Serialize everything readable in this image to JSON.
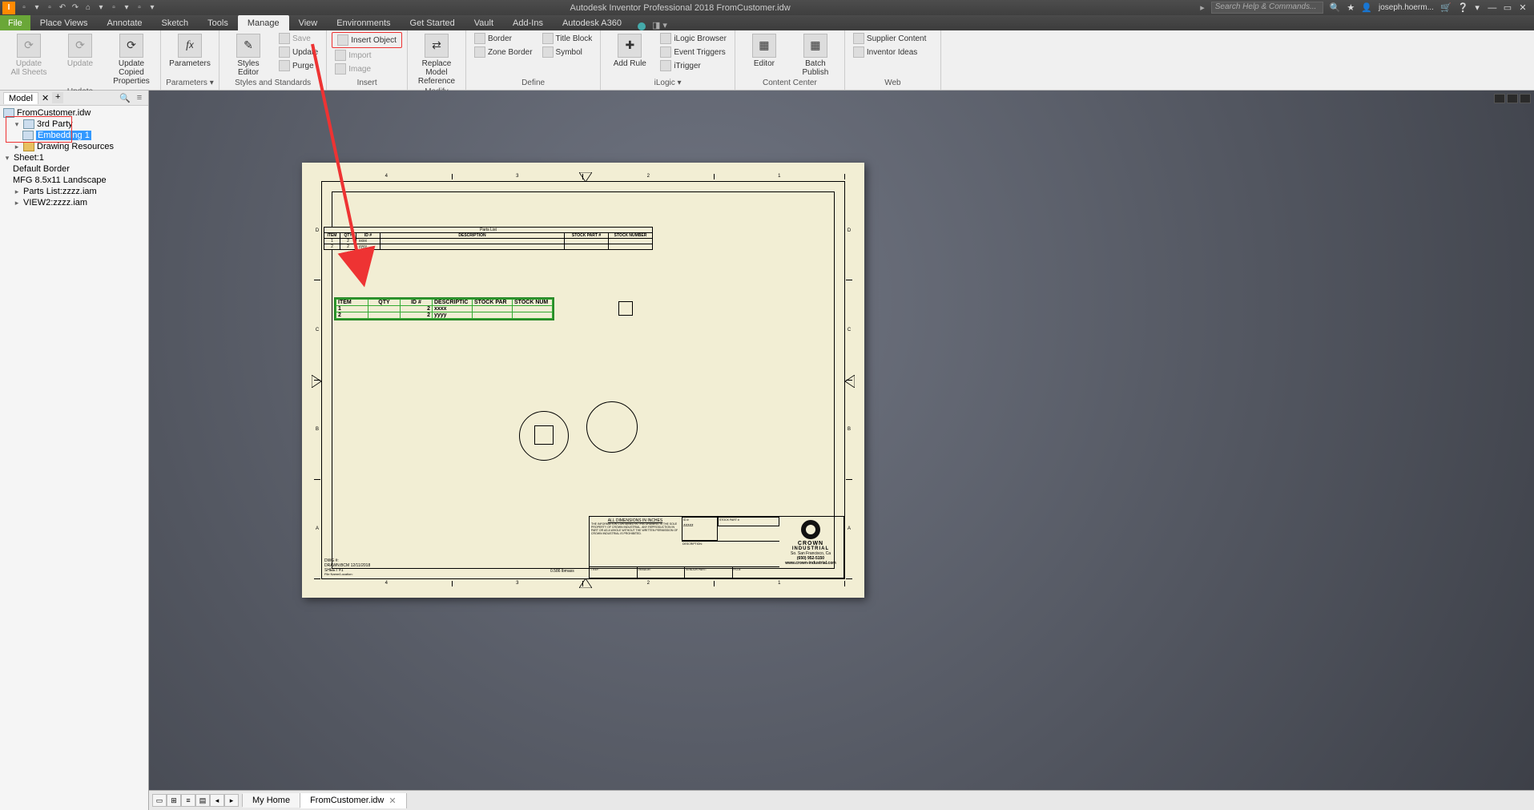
{
  "app": {
    "title": "Autodesk Inventor Professional 2018   FromCustomer.idw",
    "search_placeholder": "Search Help & Commands...",
    "user": "joseph.hoerm..."
  },
  "qat_tooltips": [
    "new",
    "open",
    "save",
    "undo",
    "redo",
    "home",
    "select",
    "print",
    "measure",
    "settings"
  ],
  "menu_tabs": {
    "file": "File",
    "items": [
      "Place Views",
      "Annotate",
      "Sketch",
      "Tools",
      "Manage",
      "View",
      "Environments",
      "Get Started",
      "Vault",
      "Add-Ins",
      "Autodesk A360"
    ],
    "active": "Manage"
  },
  "ribbon": {
    "update": {
      "label": "Update",
      "update_all": "Update\nAll Sheets",
      "update": "Update",
      "update_copied": "Update Copied\nProperties"
    },
    "parameters": {
      "label": "Parameters ▾",
      "fx": "Parameters"
    },
    "styles": {
      "label": "Styles and Standards",
      "editor": "Styles Editor",
      "save": "Save",
      "update": "Update",
      "purge": "Purge"
    },
    "insert": {
      "label": "Insert",
      "object": "Insert Object",
      "import": "Import",
      "image": "Image"
    },
    "modify": {
      "label": "Modify",
      "replace": "Replace Model\nReference"
    },
    "define": {
      "label": "Define",
      "border": "Border",
      "zone": "Zone Border",
      "title": "Title Block",
      "symbol": "Symbol"
    },
    "ilogic": {
      "label": "iLogic  ▾",
      "addrule": "Add Rule",
      "browser": "iLogic Browser",
      "triggers": "Event Triggers",
      "itrigger": "iTrigger"
    },
    "content": {
      "label": "Content Center",
      "editor": "Editor",
      "batch": "Batch Publish"
    },
    "web": {
      "label": "Web",
      "supplier": "Supplier Content",
      "ideas": "Inventor Ideas"
    }
  },
  "model_panel": {
    "tab": "Model",
    "root": "FromCustomer.idw",
    "nodes": {
      "third_party": "3rd Party",
      "embedding": "Embedding 1",
      "drawing_res": "Drawing Resources",
      "sheet": "Sheet:1",
      "border": "Default Border",
      "mfg": "MFG 8.5x11 Landscape",
      "parts": "Parts List:zzzz.iam",
      "view2": "VIEW2:zzzz.iam"
    }
  },
  "parts_list": {
    "title": "Parts List",
    "headers": [
      "ITEM",
      "QTY",
      "ID #",
      "DESCRIPTION",
      "STOCK PART #",
      "STOCK NUMBER"
    ],
    "rows": [
      [
        "1",
        "2",
        "xxxx",
        "",
        "",
        ""
      ],
      [
        "2",
        "2",
        "yyyy",
        "",
        "",
        ""
      ]
    ]
  },
  "embed_table": {
    "headers": [
      "ITEM",
      "QTY",
      "ID #",
      "DESCRIPTIC",
      "STOCK PAR",
      "STOCK NUM"
    ],
    "rows": [
      [
        "1",
        "",
        "2",
        "xxxx",
        "",
        ""
      ],
      [
        "2",
        "",
        "2",
        "yyyy",
        "",
        ""
      ]
    ]
  },
  "titleblock": {
    "dim_note": "ALL DIMENSIONS IN INCHES",
    "legal": "THE INFORMATION CONTAINED IN THIS DRAWING IS THE SOLE PROPERTY OF CROWN INDUSTRIAL. ANY REPRODUCTION IN PART OR AS A WHOLE WITHOUT THE WRITTEN PERMISSION OF CROWN INDUSTRIAL IS PROHIBITED.",
    "company": "CROWN",
    "company2": "INDUSTRIAL",
    "addr": "So. San Francisco, Ca",
    "phone": "(650) 952-5150",
    "url": "www.crown-industrial.com",
    "id": "zzzzz",
    "stock_label": "STOCK PART #",
    "dwg": "DWG #:",
    "drawn": "DRAWN:BCM  12/11/2018",
    "sheet": "SHEET #1",
    "mass": "0.586 lbmass"
  },
  "ruler": {
    "nums": [
      "4",
      "3",
      "2",
      "1"
    ],
    "letters": [
      "D",
      "C",
      "B",
      "A"
    ]
  },
  "statusbar": {
    "home": "My Home",
    "doc": "FromCustomer.idw"
  }
}
